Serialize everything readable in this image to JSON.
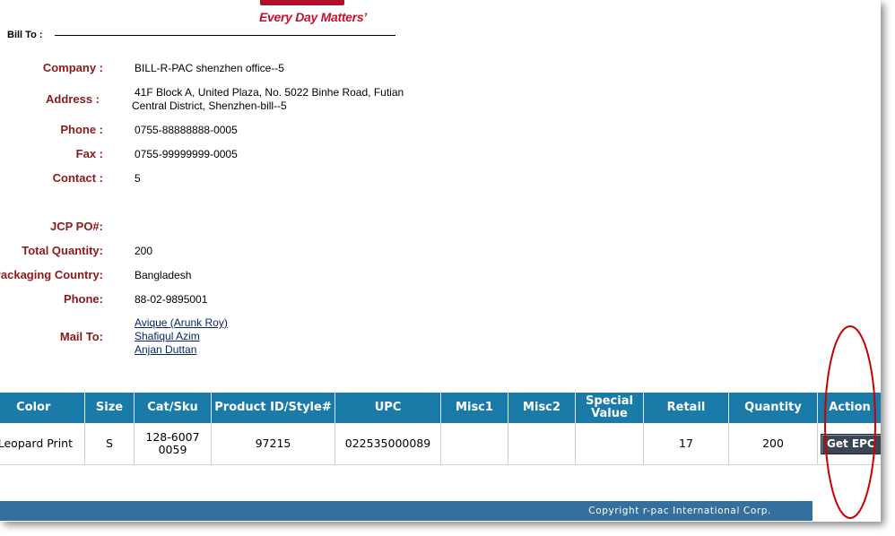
{
  "header": {
    "tagline": "Every Day Matters’",
    "bill_to_label": "Bill To :",
    "brand_color": "#c8102e"
  },
  "bill_to": {
    "company_label": "Company :",
    "company": "BILL-R-PAC shenzhen office--5",
    "address_label": "Address :",
    "address_line1": "41F Block A, United Plaza, No. 5022 Binhe Road, Futian",
    "address_line2": "Central District, Shenzhen-bill--5",
    "phone_label": "Phone :",
    "phone": "0755-88888888-0005",
    "fax_label": "Fax :",
    "fax": "0755-99999999-0005",
    "contact_label": "Contact :",
    "contact": "5"
  },
  "order": {
    "po_label": "JCP PO#:",
    "po": "",
    "total_quantity_label": "Total Quantity:",
    "total_quantity": "200",
    "packaging_country_label": "Packaging Country:",
    "packaging_country": "Bangladesh",
    "phone_label": "Phone:",
    "phone": "88-02-9895001",
    "mail_to_label": "Mail To:",
    "mail_to": [
      "Avique (Arunk Roy)",
      "Shafiqul Azim",
      "Anjan Duttan"
    ]
  },
  "table": {
    "columns": [
      "Color",
      "Size",
      "Cat/Sku",
      "Product ID/Style#",
      "UPC",
      "Misc1",
      "Misc2",
      "Special Value",
      "Retail",
      "Quantity",
      "Action"
    ],
    "rows": [
      {
        "color": "Leopard Print",
        "size": "S",
        "cat_sku_line1": "128-6007",
        "cat_sku_line2": "0059",
        "product_id": "97215",
        "upc": "022535000089",
        "misc1": "",
        "misc2": "",
        "special_value": "",
        "retail": "17",
        "quantity": "200",
        "action_label": "Get EPC"
      }
    ],
    "header_color": "#1a7aa8"
  },
  "footer": {
    "copyright": "Copyright r-pac International Corp.",
    "bar_color": "#346f9e"
  },
  "annotation": {
    "color": "#cc0000"
  }
}
